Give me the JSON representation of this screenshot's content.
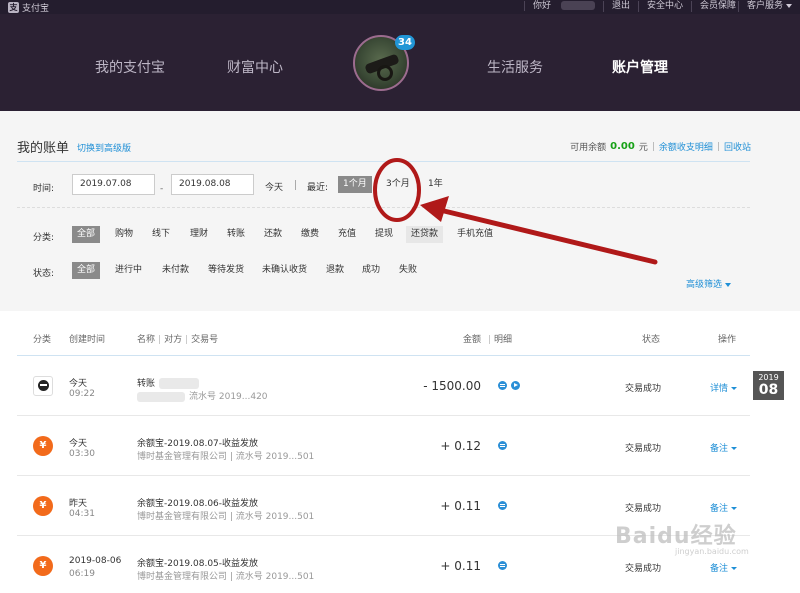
{
  "topbar": {
    "logo_text": "支付宝",
    "greeting": "你好",
    "logout": "退出",
    "security": "安全中心",
    "member": "会员保障",
    "service": "客户服务"
  },
  "nav": {
    "items": [
      "我的支付宝",
      "财富中心",
      "生活服务",
      "账户管理"
    ],
    "active": "账户管理",
    "badge_count": "34"
  },
  "bill": {
    "title": "我的账单",
    "switch_link": "切换到高级版",
    "balance_label": "可用余额",
    "balance_value": "0.00",
    "balance_unit": "元",
    "balance_detail_link": "余额收支明细",
    "recycle_link": "回收站"
  },
  "filters": {
    "time_label": "时间:",
    "start_date": "2019.07.08",
    "end_date": "2019.08.08",
    "today": "今天",
    "recent_label": "最近:",
    "recent_options": [
      "1个月",
      "3个月",
      "1年"
    ],
    "recent_selected": "1个月",
    "category_label": "分类:",
    "categories": [
      "全部",
      "购物",
      "线下",
      "理财",
      "转账",
      "还款",
      "缴费",
      "充值",
      "提现",
      "还贷款",
      "手机充值"
    ],
    "status_label": "状态:",
    "statuses": [
      "全部",
      "进行中",
      "未付款",
      "等待发货",
      "未确认收货",
      "退款",
      "成功",
      "失败"
    ],
    "advanced": "高级筛选"
  },
  "table": {
    "headers": {
      "category": "分类",
      "created": "创建时间",
      "name": "名称",
      "counterparty": "对方",
      "trade_no": "交易号",
      "amount": "金额",
      "detail": "明细",
      "status": "状态",
      "action": "操作"
    },
    "rows": [
      {
        "date": "今天",
        "time": "09:22",
        "name": "转账",
        "sub": "流水号 2019...420",
        "amount": "- 1500.00",
        "status": "交易成功",
        "action": "详情",
        "icon": "user-avatar-icon"
      },
      {
        "date": "今天",
        "time": "03:30",
        "name": "余额宝-2019.08.07-收益发放",
        "sub": "博时基金管理有限公司 | 流水号 2019...501",
        "amount": "+ 0.12",
        "status": "交易成功",
        "action": "备注",
        "icon": "yuebao-icon"
      },
      {
        "date": "昨天",
        "time": "04:31",
        "name": "余额宝-2019.08.06-收益发放",
        "sub": "博时基金管理有限公司 | 流水号 2019...501",
        "amount": "+ 0.11",
        "status": "交易成功",
        "action": "备注",
        "icon": "yuebao-icon"
      },
      {
        "date": "2019-08-06",
        "time": "06:19",
        "name": "余额宝-2019.08.05-收益发放",
        "sub": "博时基金管理有限公司 | 流水号 2019...501",
        "amount": "+ 0.11",
        "status": "交易成功",
        "action": "备注",
        "icon": "yuebao-icon"
      }
    ]
  },
  "date_tab": {
    "year": "2019",
    "month": "08"
  },
  "watermark": {
    "text": "Baidu经验",
    "url": "jingyan.baidu.com"
  },
  "colors": {
    "accent": "#1f8fd6",
    "header_bg": "#2b2133",
    "orange_icon": "#f26a1b",
    "annotation_red": "#b01919",
    "balance_green": "#17a117"
  }
}
